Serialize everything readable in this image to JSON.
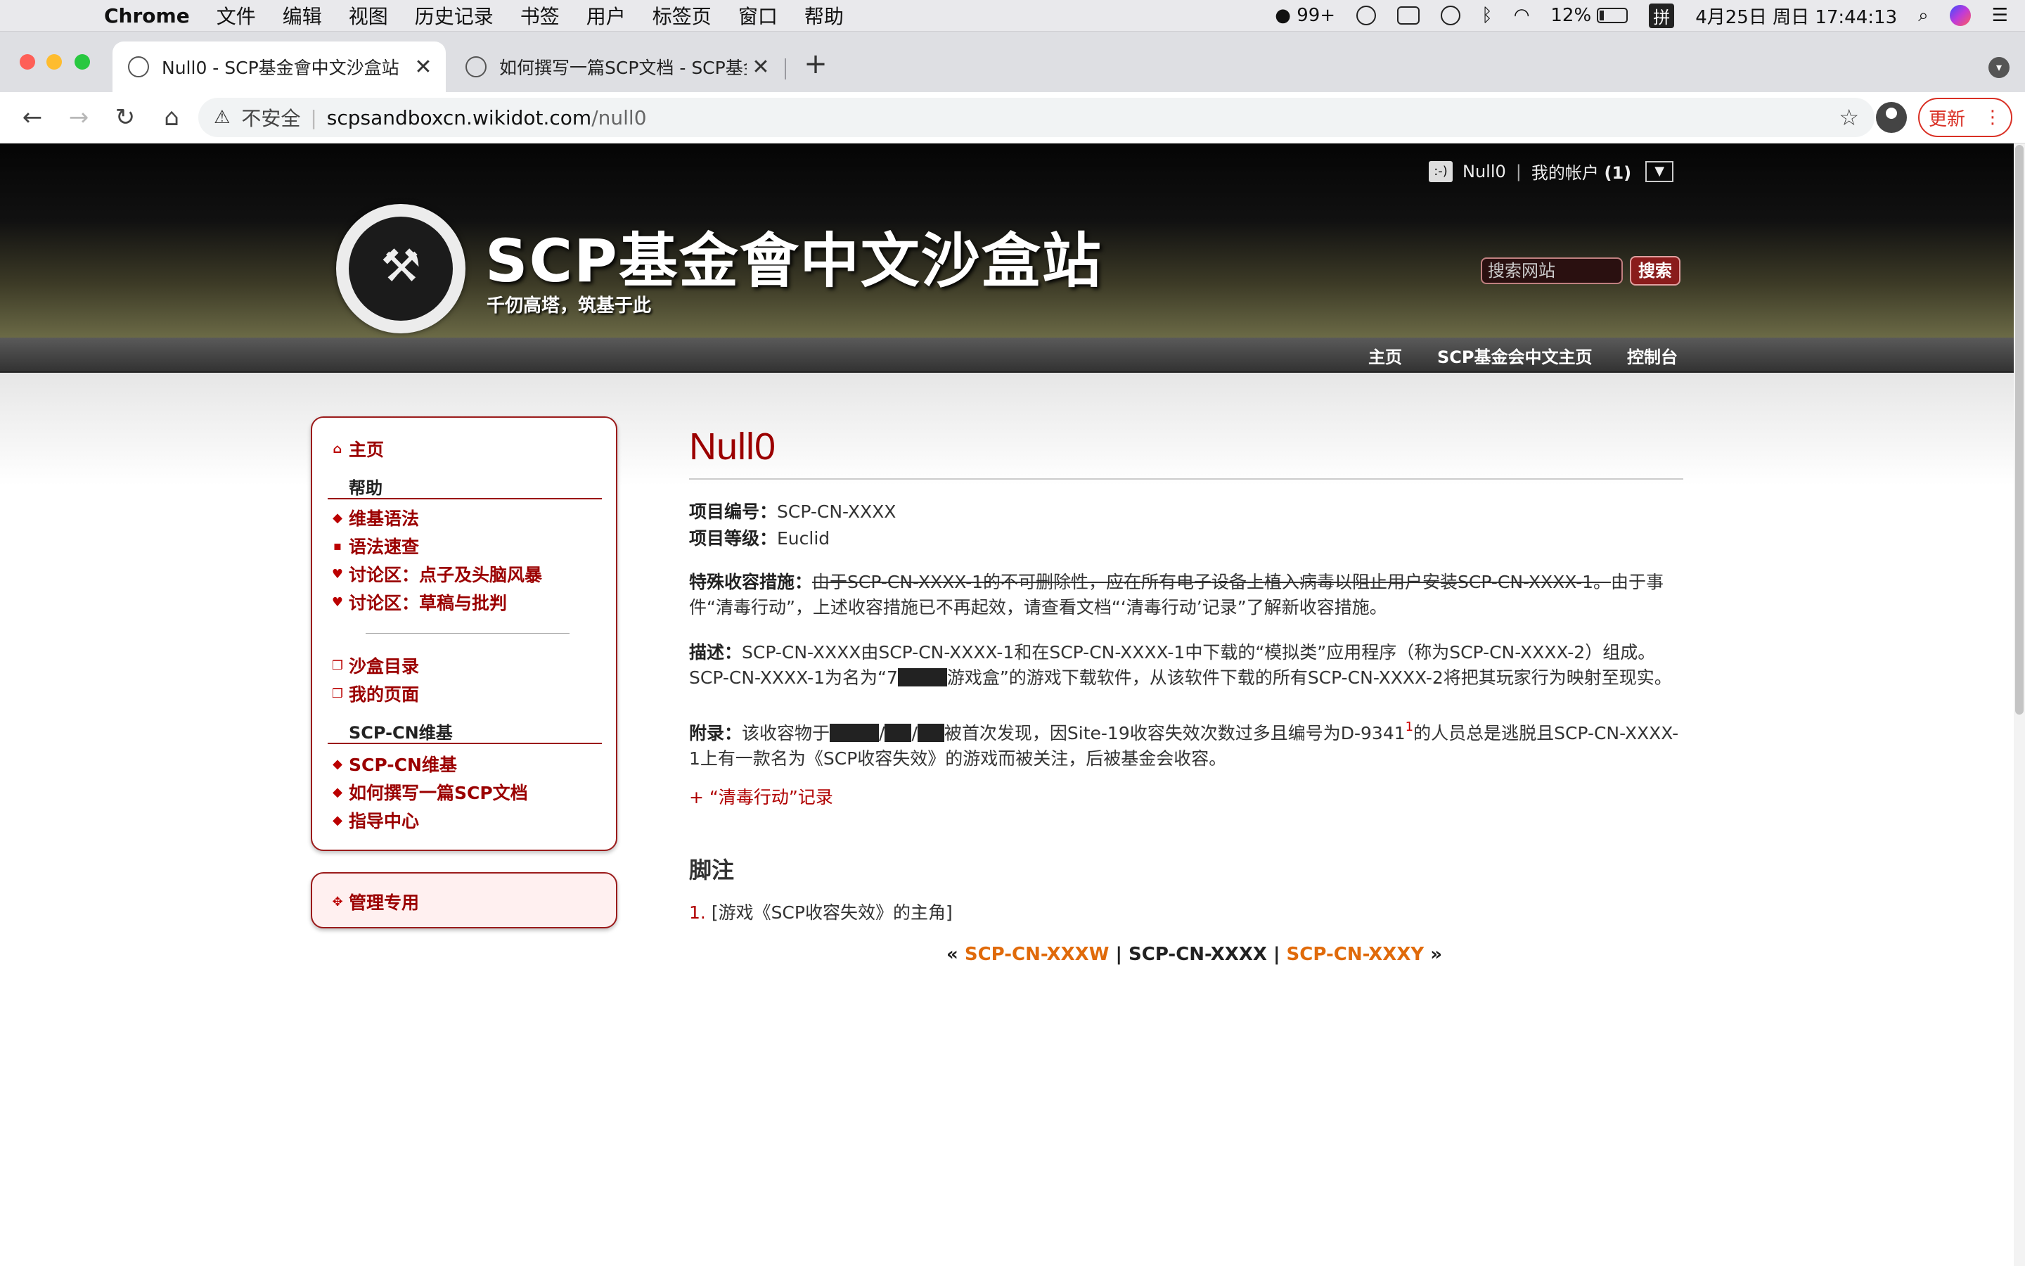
{
  "menubar": {
    "apple": "",
    "app": "Chrome",
    "items": [
      "文件",
      "编辑",
      "视图",
      "历史记录",
      "书签",
      "用户",
      "标签页",
      "窗口",
      "帮助"
    ],
    "qq_count": "99+",
    "battery": "12%",
    "ime": "拼",
    "datetime": "4月25日 周日  17:44:13"
  },
  "tabs": [
    {
      "title": "Null0 - SCP基金會中文沙盒站",
      "close": "✕"
    },
    {
      "title": "如何撰写一篇SCP文档 - SCP基金",
      "close": "✕"
    }
  ],
  "new_tab": "+",
  "toolbar": {
    "back": "←",
    "forward": "→",
    "reload": "↻",
    "home": "⌂",
    "warn_icon": "⚠",
    "insecure": "不安全",
    "url_host": "scpsandboxcn.wikidot.com",
    "url_path": "/null0",
    "star": "☆",
    "update": "更新",
    "update_menu": "⋮"
  },
  "header": {
    "account_icon": ":-)",
    "user": "Null0",
    "sep": "|",
    "my_account": "我的帐户",
    "count": "(1)",
    "dropdown": "▼",
    "logo_glyph": "⚒",
    "site_title": "SCP基金會中文沙盒站",
    "subtitle": "千仞高塔，筑基于此",
    "search_placeholder": "搜索网站",
    "search_button": "搜索",
    "nav": [
      "主页",
      "SCP基金会中文主页",
      "控制台"
    ]
  },
  "sidebar": {
    "home": "主页",
    "help_head": "帮助",
    "help_links": [
      "维基语法",
      "语法速查",
      "讨论区：点子及头脑风暴",
      "讨论区：草稿与批判"
    ],
    "sandbox_links": [
      "沙盒目录",
      "我的页面"
    ],
    "wiki_head": "SCP-CN维基",
    "wiki_links": [
      "SCP-CN维基",
      "如何撰写一篇SCP文档",
      "指导中心"
    ],
    "admin": "管理专用"
  },
  "page": {
    "title": "Null0",
    "item_no_label": "项目编号：",
    "item_no": "SCP-CN-XXXX",
    "class_label": "项目等级：",
    "class": "Euclid",
    "containment_label": "特殊收容措施：",
    "containment_struck": "由于SCP-CN-XXXX-1的不可删除性，应在所有电子设备上植入病毒以阻止用户安装SCP-CN-XXXX-1。",
    "containment_new": "由于事件“清毒行动”，上述收容措施已不再起效，请查看文档“‘清毒行动’记录”了解新收容措施。",
    "desc_label": "描述：",
    "desc_a": "SCP-CN-XXXX由SCP-CN-XXXX-1和在SCP-CN-XXXX-1中下载的“模拟类”应用程序（称为SCP-CN-XXXX-2）组成。SCP-CN-XXXX-1为名为“7",
    "desc_b": "游戏盒”的游戏下载软件，从该软件下载的所有SCP-CN-XXXX-2将把其玩家行为映射至现实。",
    "appendix_label": "附录：",
    "appendix_a": "该收容物于",
    "slash": "/",
    "appendix_b": "被首次发现，因Site-19收容失效次数过多且编号为D-9341",
    "appendix_sup": "1",
    "appendix_c": "的人员总是逃脱且SCP-CN-XXXX-1上有一款名为《SCP收容失效》的游戏而被关注，后被基金会收容。",
    "collapsible": "+ “清毒行动”记录",
    "footnotes_head": "脚注",
    "footnote_num": "1.",
    "footnote_text": "[游戏《SCP收容失效》的主角]",
    "pager_prev": "SCP-CN-XXXW",
    "pager_current": "SCP-CN-XXXX",
    "pager_next": "SCP-CN-XXXY",
    "pager_left": "«",
    "pager_right": "»",
    "pager_sep": "|"
  },
  "colors": {
    "accent": "#9b0000",
    "pager_link": "#e06a0a",
    "update": "#d93025"
  }
}
